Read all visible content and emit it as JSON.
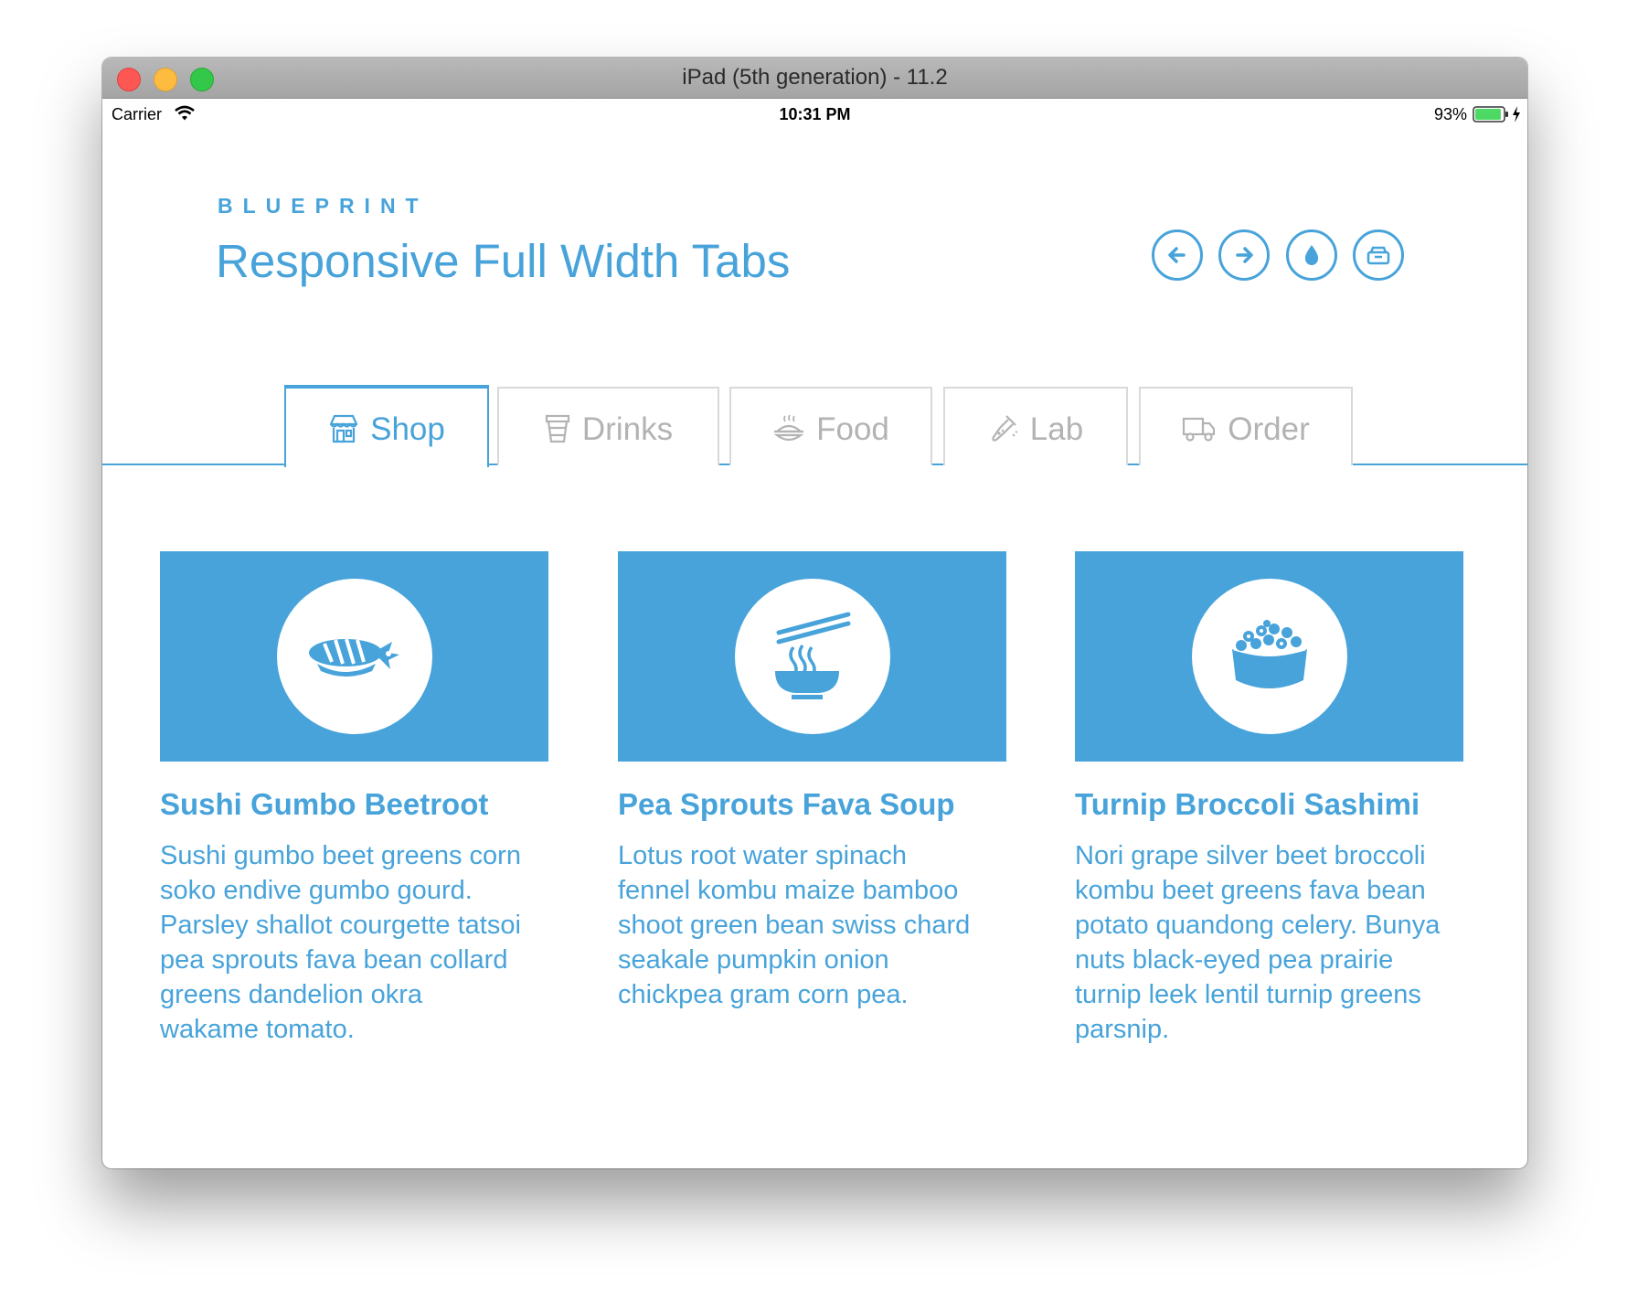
{
  "window": {
    "title": "iPad (5th generation) - 11.2"
  },
  "statusbar": {
    "carrier": "Carrier",
    "time": "10:31 PM",
    "battery": "93%",
    "battery_level": 0.93
  },
  "header": {
    "brand": "BLUEPRINT",
    "title": "Responsive Full Width Tabs",
    "buttons": [
      "arrow-left-icon",
      "arrow-right-icon",
      "drop-icon",
      "archive-icon"
    ]
  },
  "tabs": [
    {
      "label": "Shop",
      "icon": "shop-icon",
      "active": true
    },
    {
      "label": "Drinks",
      "icon": "cup-icon",
      "active": false
    },
    {
      "label": "Food",
      "icon": "food-icon",
      "active": false
    },
    {
      "label": "Lab",
      "icon": "lab-icon",
      "active": false
    },
    {
      "label": "Order",
      "icon": "truck-icon",
      "active": false
    }
  ],
  "cards": [
    {
      "icon": "sushi-icon",
      "title": "Sushi Gumbo Beetroot",
      "lines": [
        "Sushi gumbo beet greens corn",
        "soko endive gumbo gourd.",
        "Parsley shallot courgette tatsoi",
        "pea sprouts fava bean collard",
        "greens dandelion okra",
        "wakame tomato."
      ]
    },
    {
      "icon": "noodle-bowl-icon",
      "title": "Pea Sprouts Fava Soup",
      "lines": [
        "Lotus root water spinach",
        "fennel kombu maize bamboo",
        "shoot green bean swiss chard",
        "seakale pumpkin onion",
        "chickpea gram corn pea."
      ]
    },
    {
      "icon": "roe-sushi-icon",
      "title": "Turnip Broccoli Sashimi",
      "lines": [
        "Nori grape silver beet broccoli",
        "kombu beet greens fava bean",
        "potato quandong celery. Bunya",
        "nuts black-eyed pea prairie",
        "turnip leek lentil turnip greens",
        "parsnip."
      ]
    }
  ],
  "colors": {
    "accent": "#47a3da",
    "inactive": "#b3b3b3",
    "tab_border": "#d9d9d9"
  }
}
